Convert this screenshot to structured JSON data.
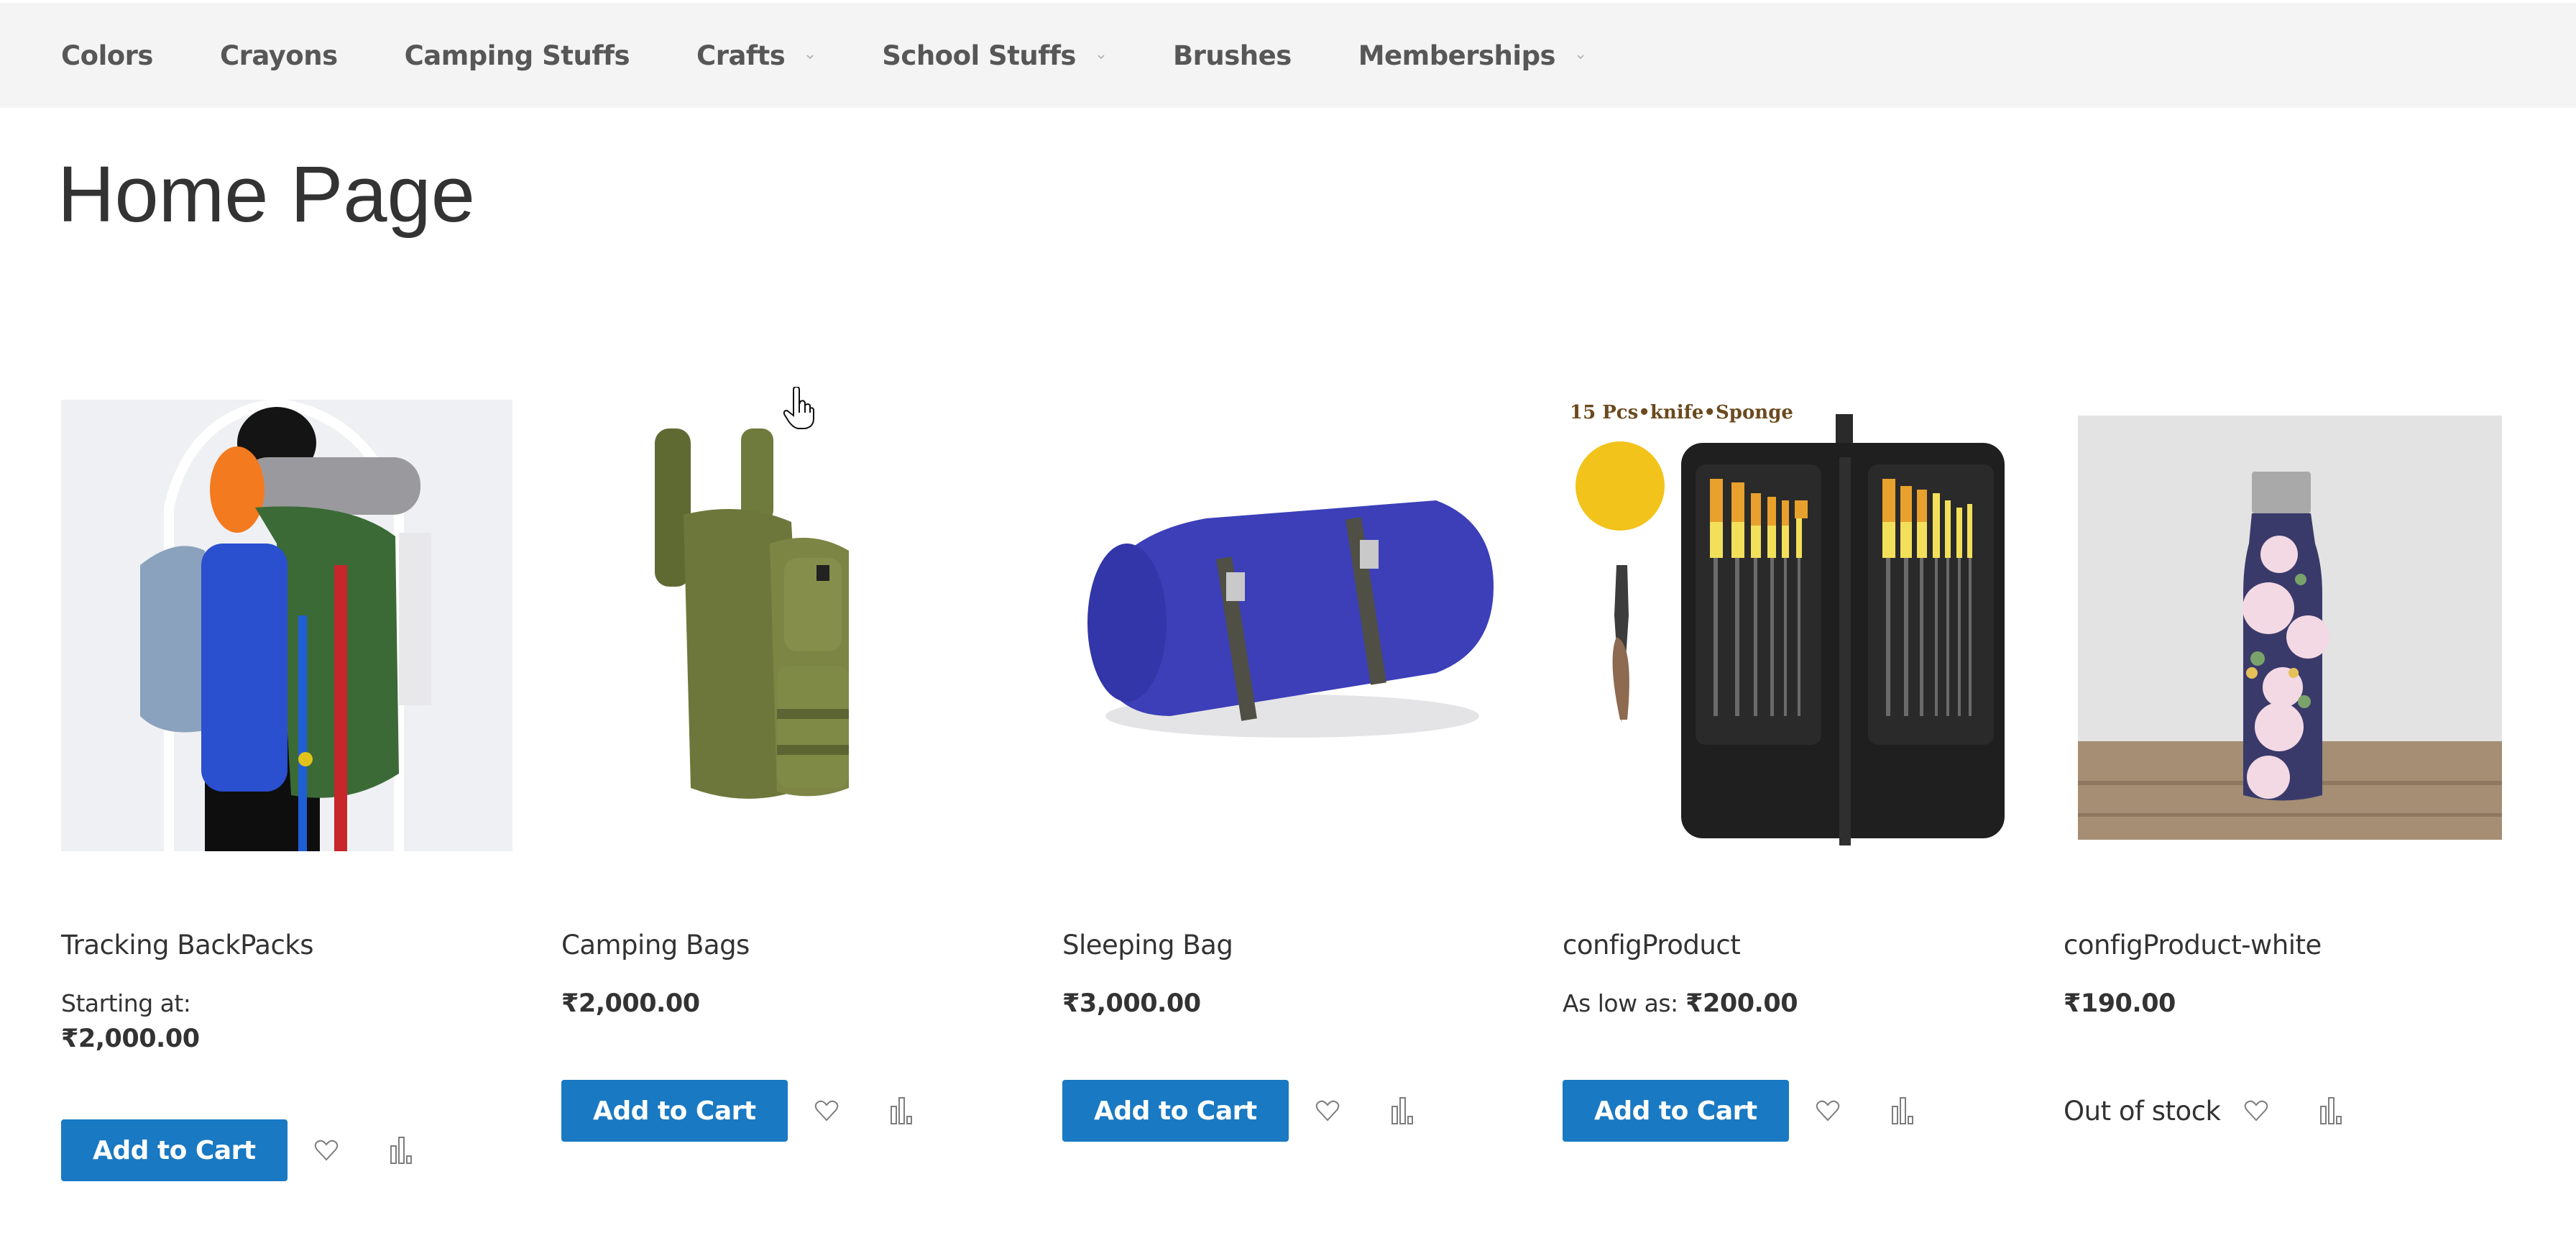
{
  "nav": {
    "items": [
      {
        "label": "Colors",
        "has_dropdown": false
      },
      {
        "label": "Crayons",
        "has_dropdown": false
      },
      {
        "label": "Camping Stuffs",
        "has_dropdown": false
      },
      {
        "label": "Crafts",
        "has_dropdown": true
      },
      {
        "label": "School Stuffs",
        "has_dropdown": true
      },
      {
        "label": "Brushes",
        "has_dropdown": false
      },
      {
        "label": "Memberships",
        "has_dropdown": true
      }
    ]
  },
  "page": {
    "title": "Home Page"
  },
  "colors": {
    "nav_bg": "#f4f4f4",
    "nav_text": "#575757",
    "primary_button": "#1979c3",
    "text": "#333333"
  },
  "products": [
    {
      "name": "Tracking BackPacks",
      "image": "backpack-with-sleeping-mat-photo",
      "price_label": "Starting at:",
      "price": "₹2,000.00",
      "price_layout": "stacked",
      "action": "Add to Cart",
      "in_stock": true
    },
    {
      "name": "Camping Bags",
      "image": "olive-tactical-backpack-photo",
      "price_label": "",
      "price": "₹2,000.00",
      "price_layout": "inline",
      "action": "Add to Cart",
      "in_stock": true
    },
    {
      "name": "Sleeping Bag",
      "image": "rolled-blue-sleeping-bag-photo",
      "price_label": "",
      "price": "₹3,000.00",
      "price_layout": "inline",
      "action": "Add to Cart",
      "in_stock": true
    },
    {
      "name": "configProduct",
      "image": "paint-brush-set-photo",
      "image_caption": "15 Pcs•knife•Sponge",
      "price_label": "As low as:",
      "price": "₹200.00",
      "price_layout": "inline",
      "action": "Add to Cart",
      "in_stock": true
    },
    {
      "name": "configProduct-white",
      "image": "floral-water-bottle-photo",
      "price_label": "",
      "price": "₹190.00",
      "price_layout": "inline",
      "action": "",
      "stock_label": "Out of stock",
      "in_stock": false
    }
  ],
  "icons": {
    "wishlist": "heart-icon",
    "compare": "compare-bars-icon",
    "dropdown": "chevron-down-icon",
    "cursor": "hand-pointer-cursor"
  }
}
